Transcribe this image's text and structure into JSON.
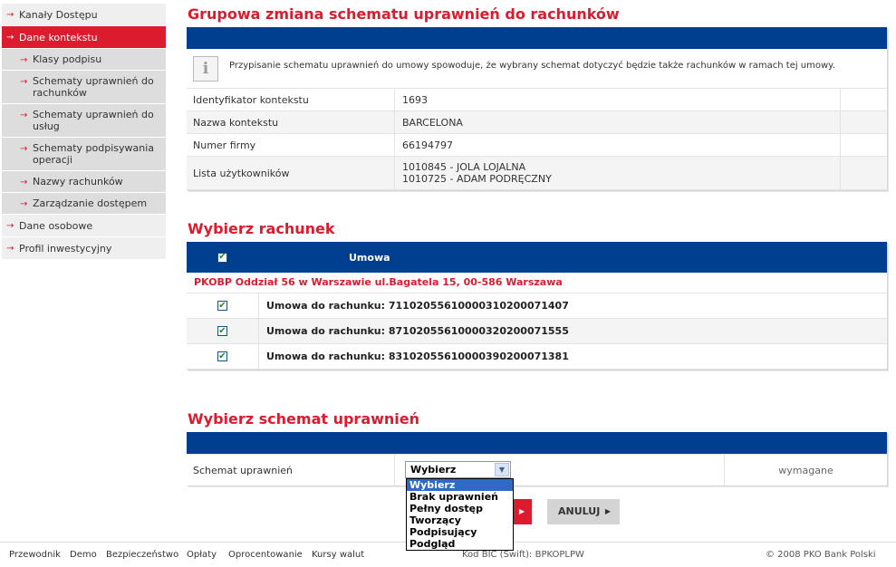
{
  "sidebar": {
    "items": [
      {
        "label": "Kanały Dostępu",
        "level": "top",
        "active": false
      },
      {
        "label": "Dane kontekstu",
        "level": "top",
        "active": true
      },
      {
        "label": "Klasy podpisu",
        "level": "sub",
        "active": false
      },
      {
        "label": "Schematy uprawnień do rachunków",
        "level": "sub",
        "active": false
      },
      {
        "label": "Schematy uprawnień do usług",
        "level": "sub",
        "active": false
      },
      {
        "label": "Schematy podpisywania operacji",
        "level": "sub",
        "active": false
      },
      {
        "label": "Nazwy rachunków",
        "level": "sub",
        "active": false
      },
      {
        "label": "Zarządzanie dostępem",
        "level": "sub",
        "active": false
      },
      {
        "label": "Dane osobowe",
        "level": "top",
        "active": false
      },
      {
        "label": "Profil inwestycyjny",
        "level": "top",
        "active": false
      }
    ]
  },
  "page": {
    "title": "Grupowa zmiana schematu uprawnień do rachunków",
    "info_text": "Przypisanie schematu uprawnień do umowy spowoduje, że wybrany schemat dotyczyć będzie także rachunków w ramach tej umowy.",
    "info_icon_glyph": "i",
    "details": [
      {
        "label": "Identyfikator kontekstu",
        "values": [
          "1693"
        ]
      },
      {
        "label": "Nazwa kontekstu",
        "values": [
          "BARCELONA"
        ]
      },
      {
        "label": "Numer firmy",
        "values": [
          "66194797"
        ]
      },
      {
        "label": "Lista użytkowników",
        "values": [
          "1010845 - JOLA LOJALNA",
          "1010725 - ADAM PODRĘCZNY"
        ]
      }
    ]
  },
  "accounts": {
    "title": "Wybierz rachunek",
    "header_label": "Umowa",
    "select_all_checked": true,
    "branch": "PKOBP Oddział 56 w Warszawie ul.Bagatela 15, 00-586 Warszawa",
    "rows": [
      {
        "label": "Umowa do rachunku: 71102055610000310200071407",
        "checked": true
      },
      {
        "label": "Umowa do rachunku: 87102055610000320200071555",
        "checked": true
      },
      {
        "label": "Umowa do rachunku: 83102055610000390200071381",
        "checked": true
      }
    ]
  },
  "schema": {
    "title": "Wybierz schemat uprawnień",
    "field_label": "Schemat uprawnień",
    "selected": "Wybierz",
    "required_text": "wymagane",
    "options": [
      "Wybierz",
      "Brak uprawnień",
      "Pełny dostęp",
      "Tworzący",
      "Podpisujący",
      "Podgląd"
    ]
  },
  "buttons": {
    "submit_arrow": "▶",
    "cancel_label": "ANULUJ",
    "cancel_arrow": "▶"
  },
  "footer": {
    "links": [
      "Przewodnik",
      "Demo",
      "Bezpieczeństwo",
      "Opłaty",
      "Oprocentowanie",
      "Kursy walut"
    ],
    "bic": "Kod BIC (Swift): BPKOPLPW",
    "copyright": "© 2008 PKO Bank Polski"
  },
  "icons": {
    "sidebar_arrow": "→",
    "dropdown_chevron": "▼"
  },
  "colors": {
    "accent_red": "#dc1b2e",
    "header_blue": "#003f8f",
    "selection_blue": "#316ac5"
  }
}
